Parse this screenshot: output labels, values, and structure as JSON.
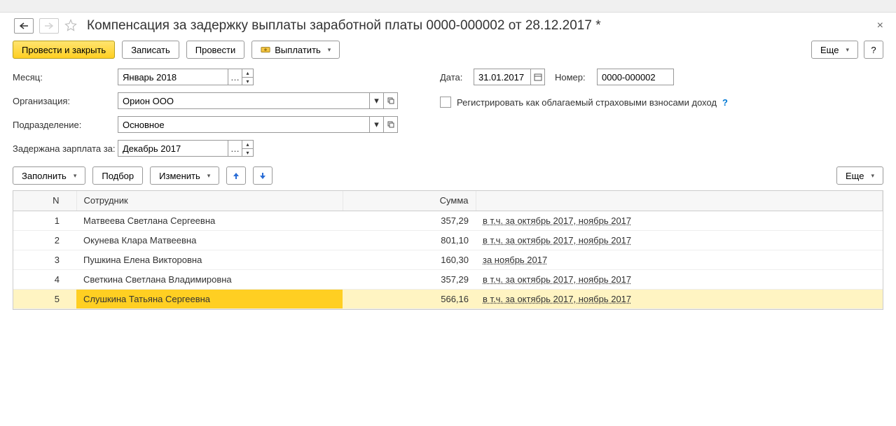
{
  "title": "Компенсация за задержку выплаты заработной платы 0000-000002 от 28.12.2017 *",
  "toolbar": {
    "primary": "Провести и закрыть",
    "write": "Записать",
    "post": "Провести",
    "pay": "Выплатить",
    "more": "Еще",
    "help": "?"
  },
  "form": {
    "month_label": "Месяц:",
    "month_value": "Январь 2018",
    "org_label": "Организация:",
    "org_value": "Орион ООО",
    "dept_label": "Подразделение:",
    "dept_value": "Основное",
    "delayed_label": "Задержана зарплата за:",
    "delayed_value": "Декабрь 2017",
    "date_label": "Дата:",
    "date_value": "31.01.2017",
    "number_label": "Номер:",
    "number_value": "0000-000002",
    "register_label": "Регистрировать как облагаемый страховыми взносами доход"
  },
  "table_toolbar": {
    "fill": "Заполнить",
    "pick": "Подбор",
    "edit": "Изменить",
    "more": "Еще"
  },
  "table": {
    "headers": {
      "n": "N",
      "employee": "Сотрудник",
      "sum": "Сумма"
    },
    "rows": [
      {
        "n": "1",
        "employee": "Матвеева Светлана Сергеевна",
        "sum": "357,29",
        "link": "в т.ч. за октябрь 2017, ноябрь 2017"
      },
      {
        "n": "2",
        "employee": "Окунева Клара Матвеевна",
        "sum": "801,10",
        "link": "в т.ч. за октябрь 2017, ноябрь 2017"
      },
      {
        "n": "3",
        "employee": "Пушкина Елена Викторовна",
        "sum": "160,30",
        "link": "за ноябрь 2017"
      },
      {
        "n": "4",
        "employee": "Светкина Светлана Владимировна",
        "sum": "357,29",
        "link": "в т.ч. за октябрь 2017, ноябрь 2017"
      },
      {
        "n": "5",
        "employee": "Слушкина Татьяна Сергеевна",
        "sum": "566,16",
        "link": "в т.ч. за октябрь 2017, ноябрь 2017"
      }
    ],
    "selected_index": 4
  }
}
